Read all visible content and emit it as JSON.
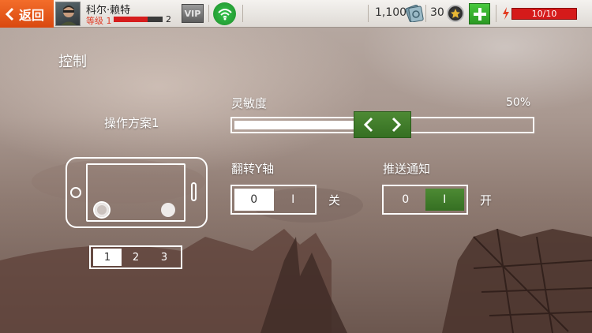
{
  "topbar": {
    "back_label": "返回",
    "player_name": "科尔·赖特",
    "level_label": "等级 1",
    "next_level": "2",
    "xp_progress": 0.7,
    "vip_label": "VIP",
    "cash": "1,100",
    "gold": "30",
    "energy": "10/10",
    "colors": {
      "back": "#e8581b",
      "energy": "#d51a1a",
      "add": "#3ab331"
    }
  },
  "controls": {
    "title": "控制",
    "scheme_label": "操作方案1",
    "scheme_tabs": [
      "1",
      "2",
      "3"
    ],
    "selected_scheme": "1",
    "sensitivity": {
      "label": "灵敏度",
      "value": "50%",
      "fraction": 0.5
    },
    "invert_y": {
      "label": "翻转Y轴",
      "off": "0",
      "on": "I",
      "state": "关"
    },
    "push": {
      "label": "推送通知",
      "off": "0",
      "on": "I",
      "state": "开"
    },
    "accent_color": "#3f7d2b"
  }
}
